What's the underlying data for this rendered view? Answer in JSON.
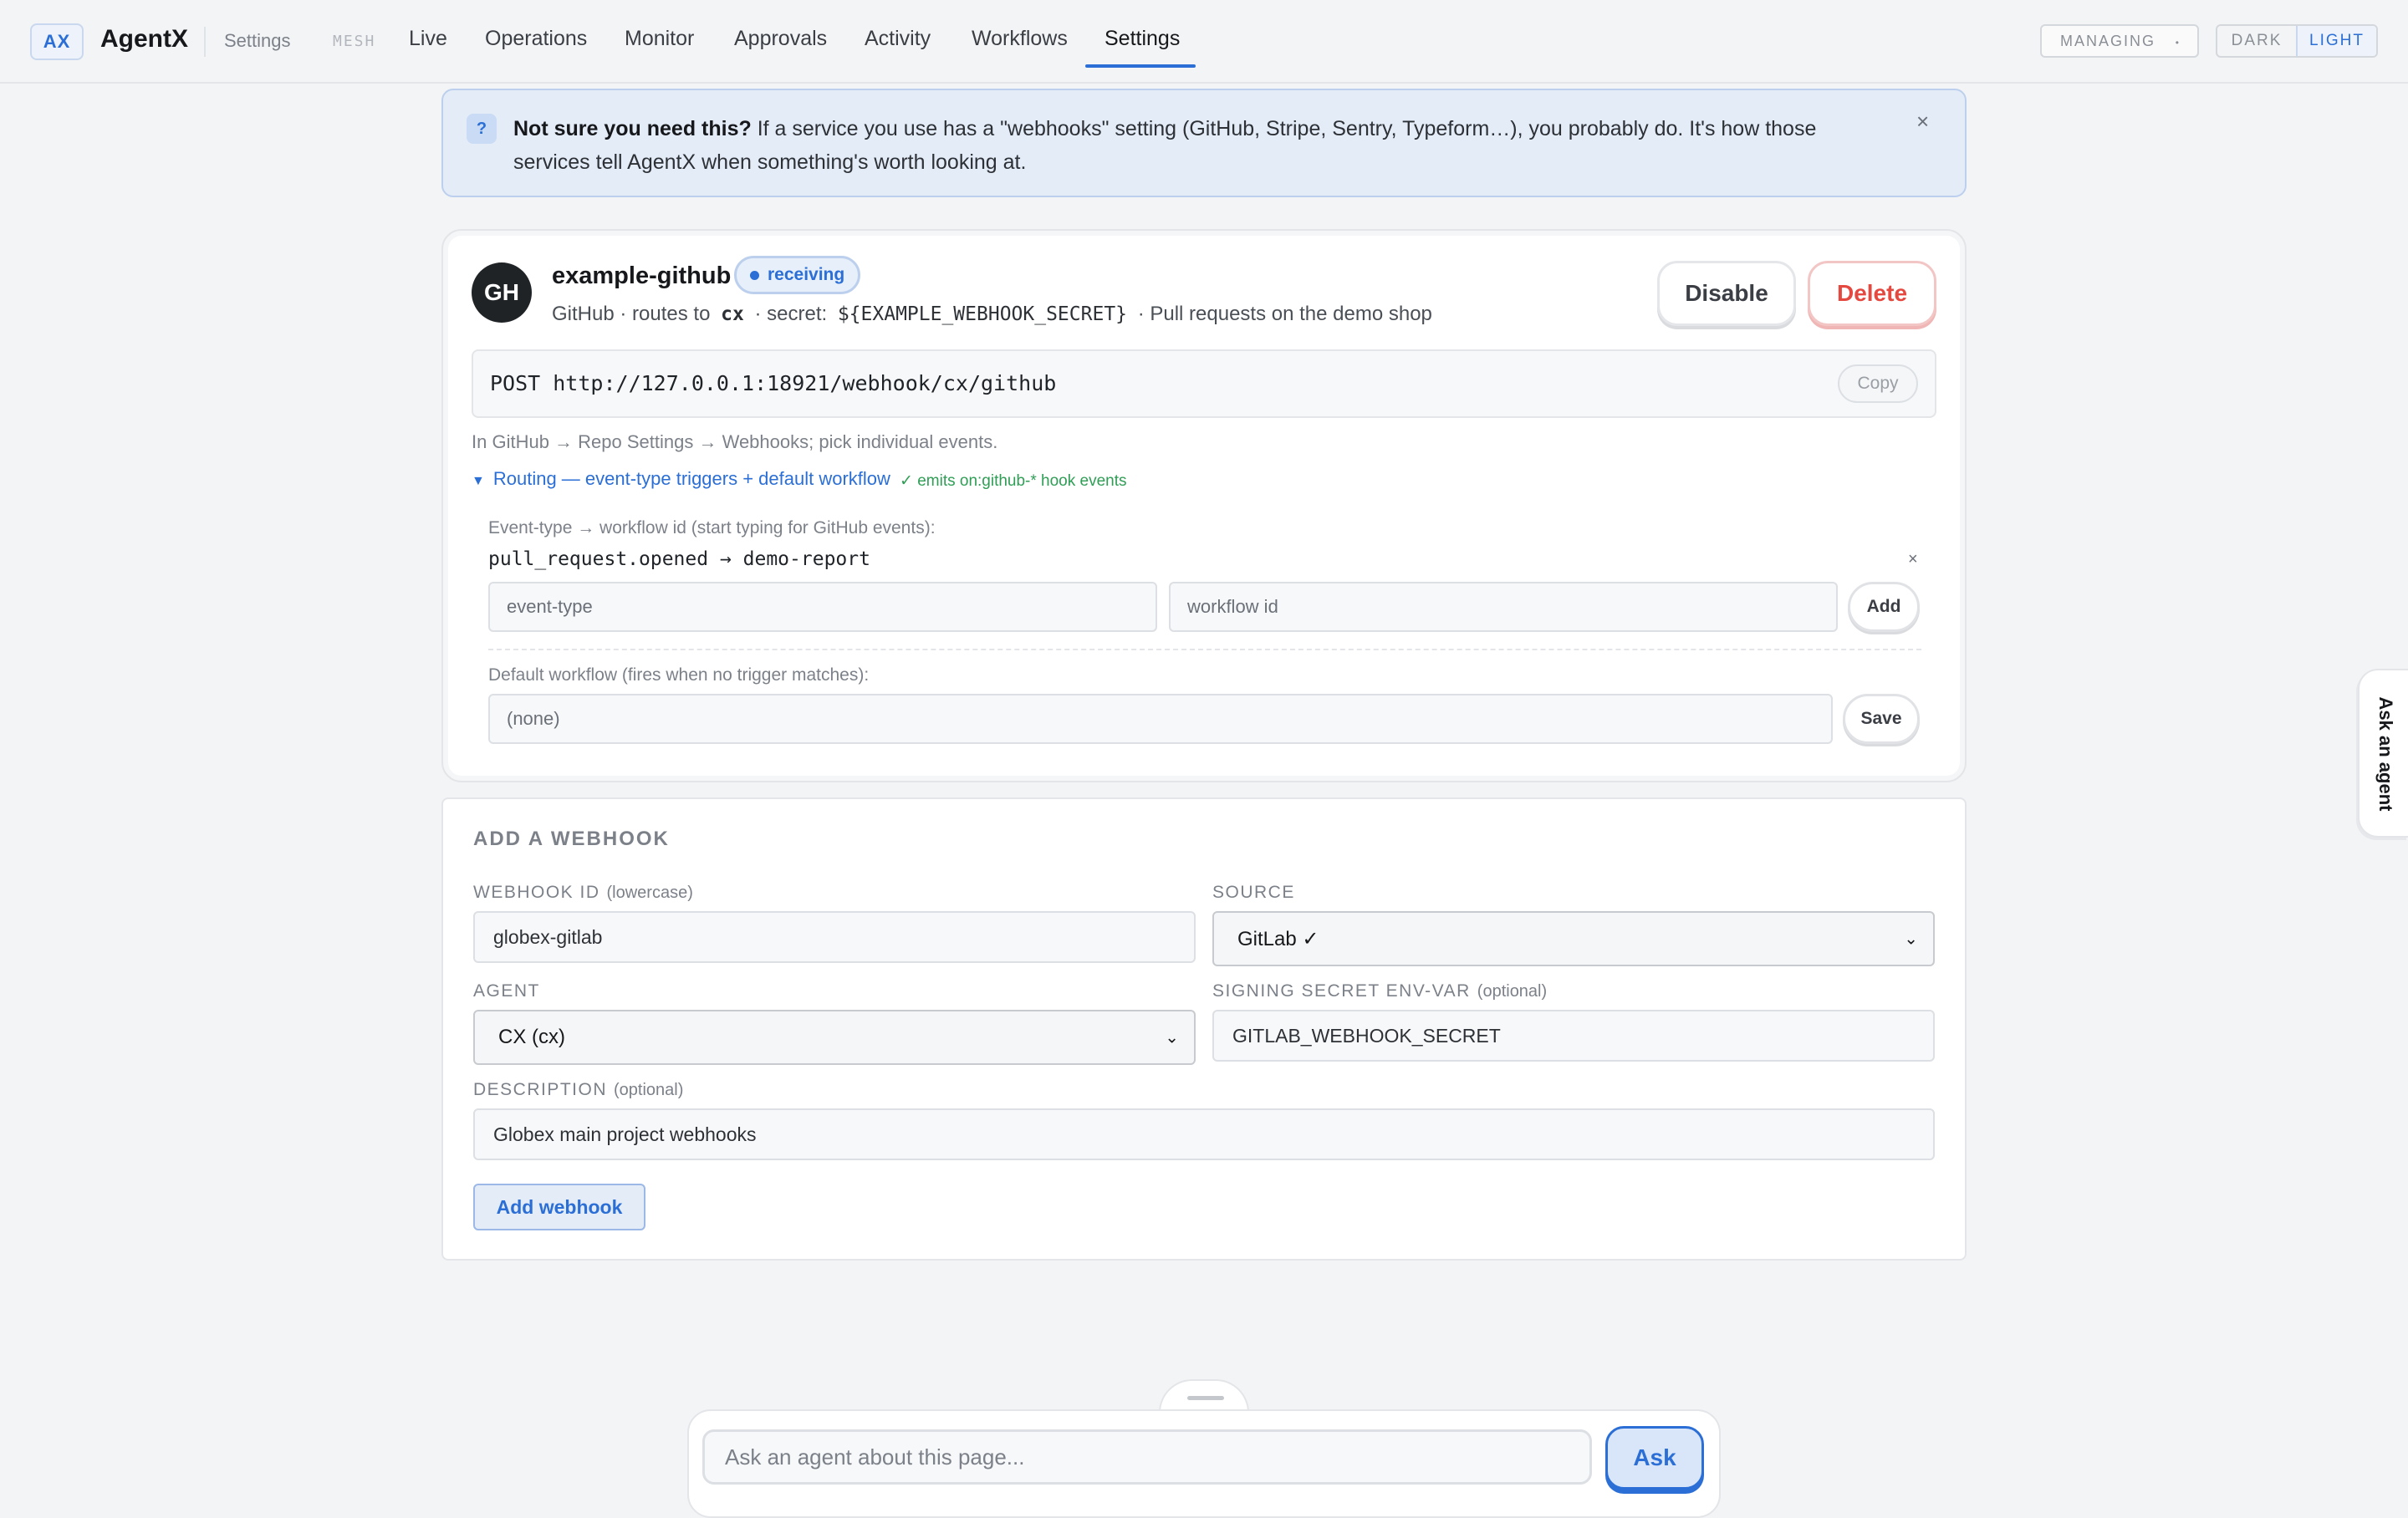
{
  "header": {
    "logo": "AX",
    "app_name": "AgentX",
    "breadcrumb": "Settings",
    "mesh_label": "MESH",
    "nav": [
      "Live",
      "Operations",
      "Monitor",
      "Approvals",
      "Activity",
      "Workflows",
      "Settings"
    ],
    "active_nav": "Settings",
    "managing_label": "MANAGING",
    "managing_dot": "•",
    "theme_dark": "DARK",
    "theme_light": "LIGHT",
    "active_theme": "LIGHT"
  },
  "banner": {
    "icon": "?",
    "bold": "Not sure you need this?",
    "text": " If a service you use has a \"webhooks\" setting (GitHub, Stripe, Sentry, Typeform…), you probably do. It's how those services tell AgentX when something's worth looking at.",
    "close": "×"
  },
  "webhook": {
    "avatar": "GH",
    "name": "example-github",
    "status": "receiving",
    "source": "GitHub",
    "routes_prefix": "· routes to",
    "agent": "cx",
    "secret_prefix": "· secret:",
    "secret": "${EXAMPLE_WEBHOOK_SECRET}",
    "description": "· Pull requests on the demo shop",
    "disable_label": "Disable",
    "delete_label": "Delete",
    "endpoint": "POST http://127.0.0.1:18921/webhook/cx/github",
    "copy_label": "Copy",
    "hint": "In GitHub → Repo Settings → Webhooks; pick individual events.",
    "routing": {
      "toggle_icon": "▼",
      "toggle_label": "Routing — event-type triggers + default workflow",
      "emits": "✓ emits on:github-* hook events",
      "triggers_label": "Event-type → workflow id (start typing for GitHub events):",
      "rules": [
        {
          "text": "pull_request.opened → demo-report",
          "remove": "×"
        }
      ],
      "event_placeholder": "event-type",
      "workflow_placeholder": "workflow id",
      "add_label": "Add",
      "default_label": "Default workflow (fires when no trigger matches):",
      "default_placeholder": "(none)",
      "save_label": "Save"
    }
  },
  "form": {
    "title": "ADD A WEBHOOK",
    "id_label": "WEBHOOK ID",
    "id_hint": "(lowercase)",
    "id_value": "globex-gitlab",
    "source_label": "SOURCE",
    "source_value": "GitLab ✓",
    "agent_label": "AGENT",
    "agent_value": "CX (cx)",
    "secret_label": "SIGNING SECRET ENV-VAR",
    "secret_hint": "(optional)",
    "secret_value": "GITLAB_WEBHOOK_SECRET",
    "desc_label": "DESCRIPTION",
    "desc_hint": "(optional)",
    "desc_value": "Globex main project webhooks",
    "submit_label": "Add webhook"
  },
  "side_tab": "Ask an agent",
  "ask": {
    "placeholder": "Ask an agent about this page...",
    "button": "Ask"
  },
  "colors": {
    "accent": "#2b6fd6",
    "danger": "#e5483f",
    "success": "#2f9e55"
  }
}
